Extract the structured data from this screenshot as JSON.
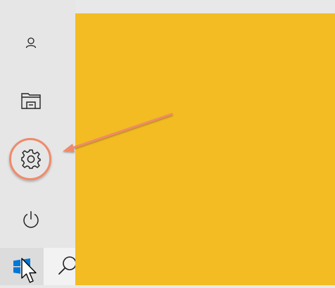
{
  "sidebar": {
    "items": [
      {
        "name": "account",
        "icon": "person-icon"
      },
      {
        "name": "documents",
        "icon": "file-explorer-icon"
      },
      {
        "name": "settings",
        "icon": "gear-icon"
      },
      {
        "name": "power",
        "icon": "power-icon"
      }
    ]
  },
  "taskbar": {
    "start_icon": "windows-logo-icon",
    "search_icon": "search-icon"
  },
  "annotation": {
    "highlight_color": "#ef8a6a",
    "target": "settings"
  },
  "colors": {
    "tile_background": "#f3bc22",
    "sidebar_background": "#e6e6e6",
    "windows_logo": "#0078d7"
  }
}
